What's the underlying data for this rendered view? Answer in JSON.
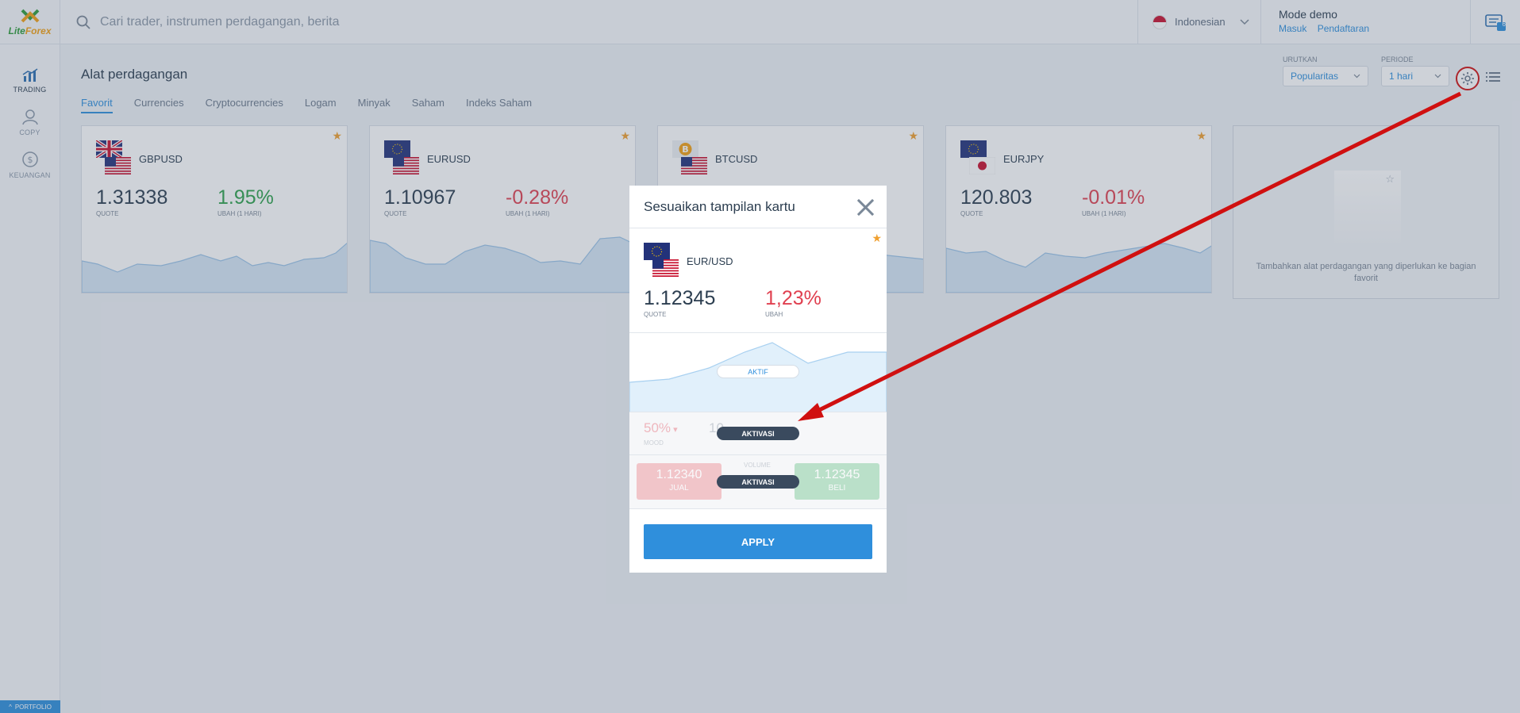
{
  "app": {
    "logo_text_a": "Lite",
    "logo_text_b": "Forex",
    "portfolio": "PORTFOLIO"
  },
  "sidebar": {
    "items": [
      {
        "label": "TRADING",
        "icon": "chart-icon"
      },
      {
        "label": "COPY",
        "icon": "user-icon"
      },
      {
        "label": "KEUANGAN",
        "icon": "dollar-icon"
      }
    ]
  },
  "topbar": {
    "search_placeholder": "Cari trader, instrumen perdagangan, berita",
    "language": "Indonesian",
    "mode": "Mode demo",
    "login": "Masuk",
    "register": "Pendaftaran",
    "notif_count": "6"
  },
  "main": {
    "title": "Alat perdagangan",
    "tabs": [
      "Favorit",
      "Currencies",
      "Cryptocurrencies",
      "Logam",
      "Minyak",
      "Saham",
      "Indeks Saham"
    ],
    "sort_caption": "URUTKAN",
    "sort_value": "Popularitas",
    "period_caption": "PERIODE",
    "period_value": "1 hari"
  },
  "cards": [
    {
      "symbol": "GBPUSD",
      "quote": "1.31338",
      "quote_caption": "QUOTE",
      "change": "1.95%",
      "change_caption": "UBAH (1 HARI)",
      "direction": "up"
    },
    {
      "symbol": "EURUSD",
      "quote": "1.10967",
      "quote_caption": "QUOTE",
      "change": "-0.28%",
      "change_caption": "UBAH (1 HARI)",
      "direction": "down"
    },
    {
      "symbol": "BTCUSD",
      "quote": "",
      "quote_caption": "",
      "change": "",
      "change_caption": "",
      "direction": "down"
    },
    {
      "symbol": "EURJPY",
      "quote": "120.803",
      "quote_caption": "QUOTE",
      "change": "-0.01%",
      "change_caption": "UBAH (1 HARI)",
      "direction": "down"
    }
  ],
  "add_card": {
    "hint": "Tambahkan alat perdagangan yang diperlukan ke bagian favorit"
  },
  "modal": {
    "title": "Sesuaikan tampilan kartu",
    "preview": {
      "symbol": "EUR/USD",
      "quote": "1.12345",
      "quote_caption": "QUOTE",
      "change": "1,23%",
      "change_caption": "UBAH"
    },
    "chart_pill": "AKTIF",
    "mood_value": "50%",
    "mood_caption": "MOOD",
    "mood_mid": "10",
    "mood_pill": "AKTIVASI",
    "sell_price": "1.12340",
    "sell_label": "JUAL",
    "buy_price": "1.12345",
    "buy_label": "BELI",
    "volume_caption": "VOLUME",
    "trade_pill": "AKTIVASI",
    "apply": "APPLY"
  },
  "colors": {
    "accent": "#2f8fdc",
    "up": "#2ea14c",
    "down": "#e04050",
    "star": "#f0a030",
    "annotation": "#d01010"
  }
}
